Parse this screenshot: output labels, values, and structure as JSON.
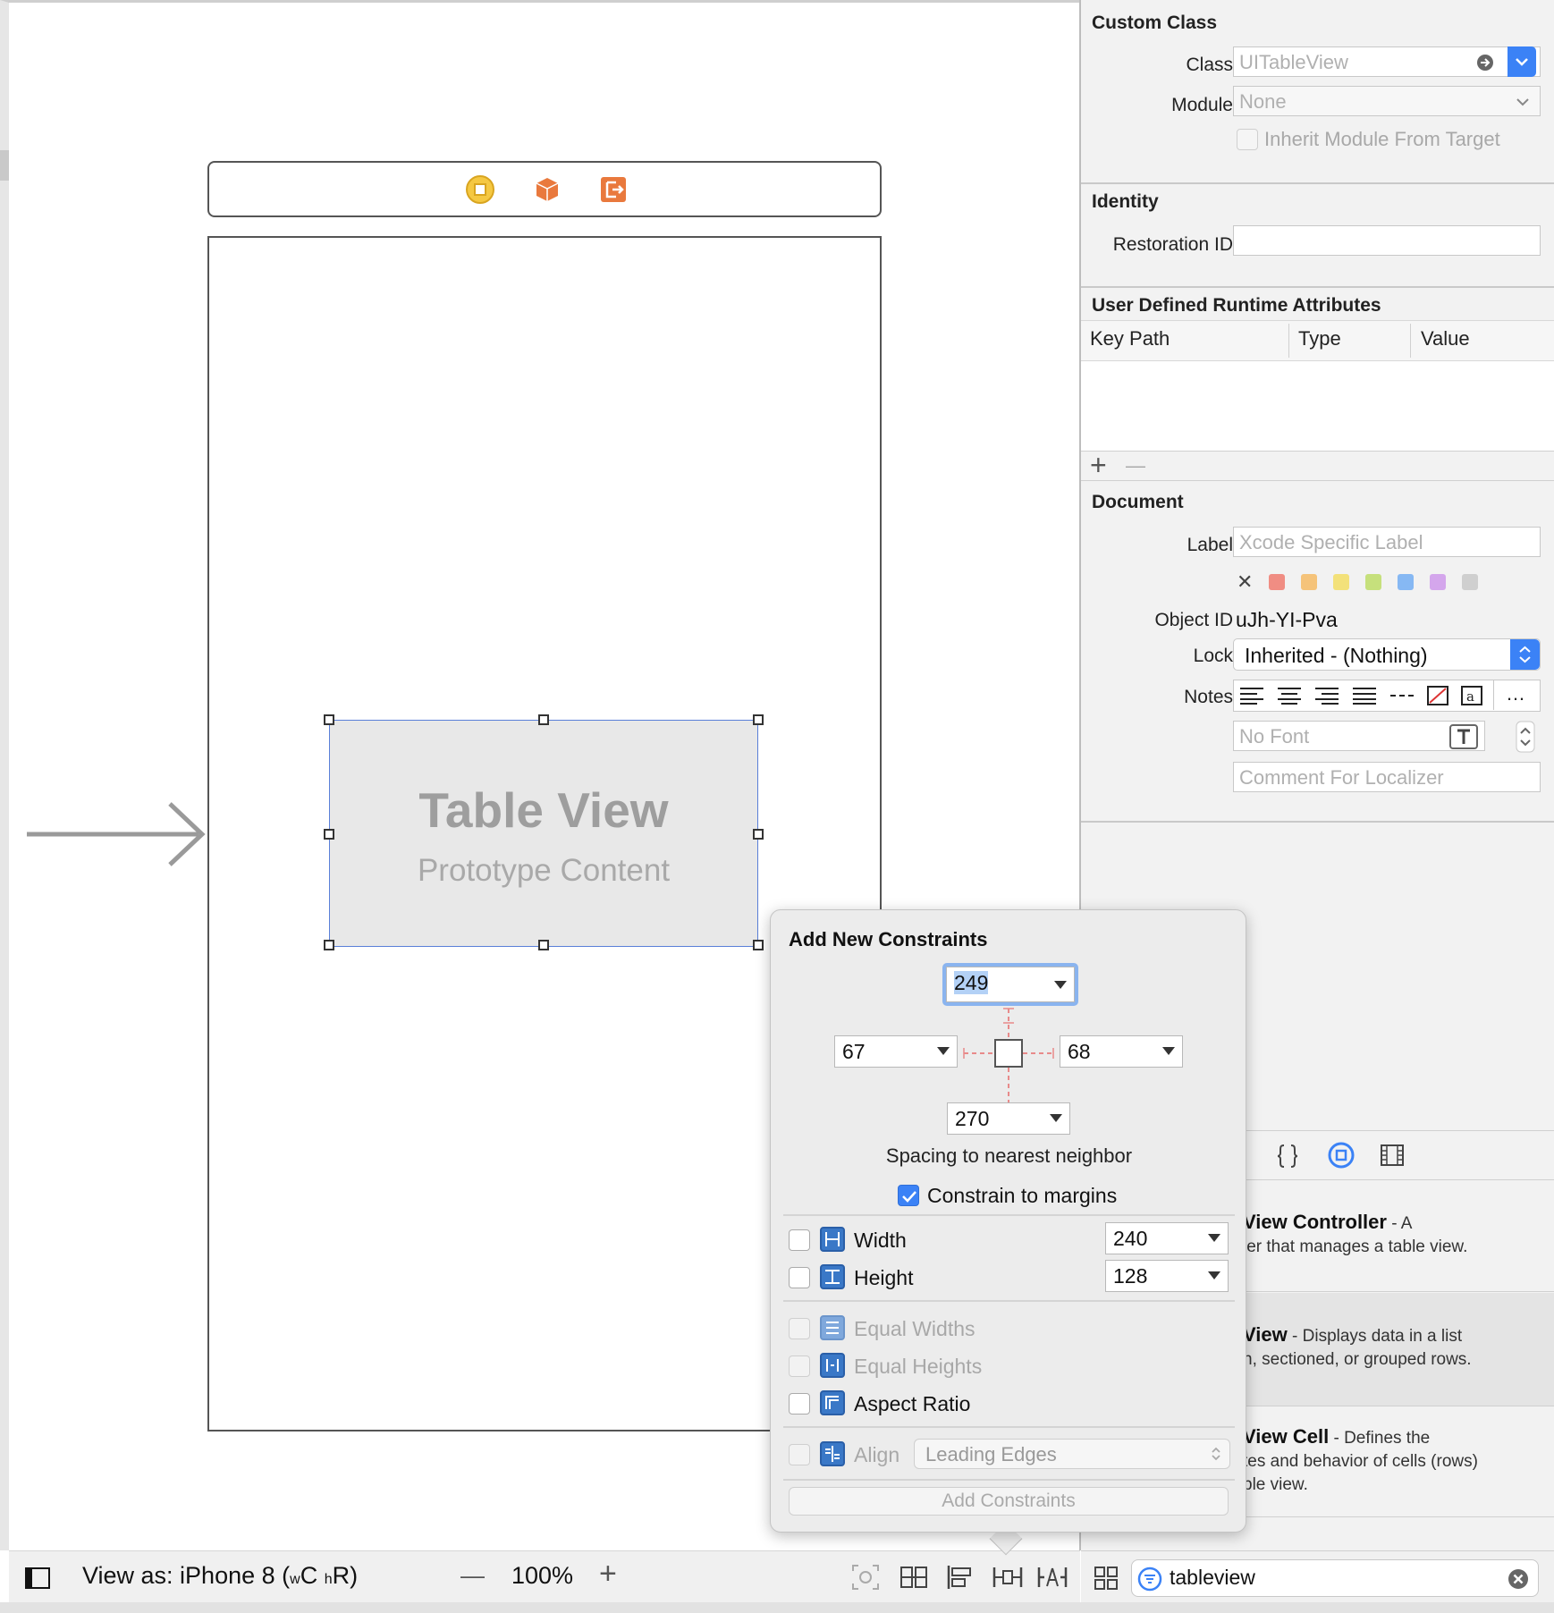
{
  "canvas": {
    "table_view_title": "Table View",
    "table_view_subtitle": "Prototype Content"
  },
  "bottom_bar": {
    "view_as": "View as: iPhone 8 (",
    "size_class_w": "w",
    "size_class_c": "C",
    "size_class_h": "h",
    "size_class_r": "R)",
    "zoom_minus": "—",
    "zoom": "100%",
    "zoom_plus": "+"
  },
  "inspector": {
    "custom_class": {
      "title": "Custom Class",
      "class_label": "Class",
      "class_placeholder": "UITableView",
      "module_label": "Module",
      "module_placeholder": "None",
      "inherit_label": "Inherit Module From Target"
    },
    "identity": {
      "title": "Identity",
      "restoration_label": "Restoration ID",
      "restoration_value": ""
    },
    "runtime_attrs": {
      "title": "User Defined Runtime Attributes",
      "col_key_path": "Key Path",
      "col_type": "Type",
      "col_value": "Value",
      "add": "+",
      "remove": "—"
    },
    "document": {
      "title": "Document",
      "label_label": "Label",
      "label_placeholder": "Xcode Specific Label",
      "clear_glyph": "✕",
      "label_colors": [
        "#f08d83",
        "#f5c37a",
        "#f3e17a",
        "#c6e07c",
        "#86b8f3",
        "#d4a6ec",
        "#cfcfcf"
      ],
      "object_id_label": "Object ID",
      "object_id": "uJh-YI-Pva",
      "lock_label": "Lock",
      "lock_value": "Inherited - (Nothing)",
      "notes_label": "Notes",
      "notes_more": "…",
      "font_placeholder": "No Font",
      "comment_placeholder": "Comment For Localizer"
    }
  },
  "library": {
    "items": [
      {
        "title": "View Controller",
        "desc_1": " - A",
        "desc_2": "ler that manages a table view."
      },
      {
        "title": "View",
        "desc_1": " - Displays data in a list",
        "desc_2": "n, sectioned, or grouped rows."
      },
      {
        "title": "View Cell",
        "desc_1": " - Defines the",
        "desc_2": "tes and behavior of cells (rows)",
        "desc_3": "ble view."
      }
    ],
    "filter_value": "tableview"
  },
  "constraints_popover": {
    "title": "Add New Constraints",
    "top": "249",
    "left": "67",
    "right": "68",
    "bottom": "270",
    "spacing_label": "Spacing to nearest neighbor",
    "constrain_margins": "Constrain to margins",
    "width_label": "Width",
    "width_value": "240",
    "height_label": "Height",
    "height_value": "128",
    "equal_widths": "Equal Widths",
    "equal_heights": "Equal Heights",
    "aspect_ratio": "Aspect Ratio",
    "align_label": "Align",
    "align_value": "Leading Edges",
    "add_button": "Add Constraints"
  }
}
